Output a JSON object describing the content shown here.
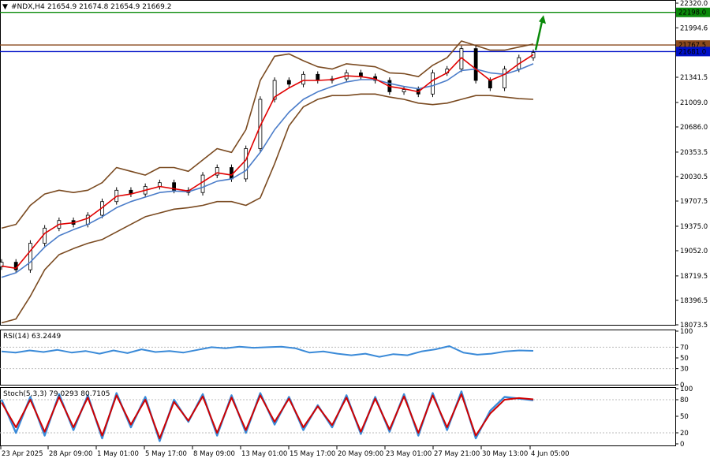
{
  "header": {
    "symbol_label": "#NDX,H4",
    "ohlc": "21654.9 21674.8 21654.9 21669.2"
  },
  "indicators": {
    "rsi_label": "RSI(14) 63.2449",
    "stoch_label": "Stoch(5,3,3) 79.0293 80.7105"
  },
  "colors": {
    "price": "#000000",
    "ema_fast": "#e00000",
    "ema_slow": "#4a7cc9",
    "bollinger": "#7a4a20",
    "resistance": "#8b4a1e",
    "support": "#0010c8",
    "target": "#0a8a0a",
    "rsi": "#3a8ad8",
    "stoch_main": "#3a8ad8",
    "stoch_signal": "#d00000"
  },
  "chart_data": [
    {
      "type": "line",
      "title": "#NDX,H4",
      "ylim": [
        18073.5,
        22320.0
      ],
      "y_ticks": [
        "22320.0",
        "21994.6",
        "21669.2",
        "21341.5",
        "21009.0",
        "20686.0",
        "20353.5",
        "20030.5",
        "19707.5",
        "19375.0",
        "19052.0",
        "18719.5",
        "18396.5",
        "18073.5"
      ],
      "x_ticks": [
        "23 Apr 2025",
        "28 Apr 09:00",
        "1 May 01:00",
        "5 May 17:00",
        "8 May 09:00",
        "13 May 01:00",
        "15 May 17:00",
        "20 May 09:00",
        "23 May 01:00",
        "27 May 21:00",
        "30 May 13:00",
        "4 Jun 05:00"
      ],
      "price_x": [
        0,
        3,
        6,
        9,
        12,
        15,
        18,
        21,
        24,
        27,
        30,
        33,
        36,
        39,
        42,
        45,
        48,
        51,
        54,
        57,
        60,
        63,
        66,
        69,
        72,
        75,
        78,
        81,
        84,
        87,
        90,
        93,
        96,
        99,
        102,
        105,
        108,
        111
      ],
      "price_close": [
        18900,
        18800,
        19150,
        19350,
        19450,
        19400,
        19520,
        19700,
        19850,
        19800,
        19900,
        19950,
        19850,
        19820,
        20050,
        20150,
        20000,
        20400,
        21050,
        21300,
        21250,
        21380,
        21300,
        21320,
        21400,
        21350,
        21300,
        21150,
        21180,
        21120,
        21400,
        21450,
        21720,
        21300,
        21200,
        21450,
        21600,
        21669
      ],
      "price_markers": [
        {
          "label": "22198.0",
          "value": 22198.0,
          "color": "#0a8a0a"
        },
        {
          "label": "21767.5",
          "value": 21767.5,
          "color": "#8b4a1e"
        },
        {
          "label": "21681.0",
          "value": 21681.0,
          "color": "#0010c8"
        }
      ],
      "series": [
        {
          "values": [
            18850,
            18820,
            19050,
            19280,
            19400,
            19420,
            19480,
            19620,
            19770,
            19800,
            19850,
            19900,
            19870,
            19840,
            19960,
            20080,
            20050,
            20250,
            20700,
            21080,
            21200,
            21300,
            21300,
            21310,
            21360,
            21350,
            21320,
            21220,
            21190,
            21150,
            21300,
            21400,
            21600,
            21450,
            21300,
            21380,
            21520,
            21640
          ]
        },
        {
          "values": [
            18700,
            18760,
            18900,
            19100,
            19250,
            19330,
            19400,
            19500,
            19620,
            19700,
            19760,
            19820,
            19840,
            19830,
            19890,
            19970,
            20000,
            20110,
            20350,
            20650,
            20880,
            21050,
            21150,
            21220,
            21280,
            21310,
            21310,
            21260,
            21220,
            21190,
            21230,
            21300,
            21430,
            21450,
            21400,
            21380,
            21440,
            21520
          ]
        },
        {
          "values": [
            19350,
            19400,
            19650,
            19800,
            19850,
            19820,
            19850,
            19950,
            20150,
            20100,
            20050,
            20150,
            20150,
            20100,
            20250,
            20400,
            20350,
            20650,
            21300,
            21620,
            21650,
            21560,
            21480,
            21450,
            21520,
            21500,
            21480,
            21400,
            21390,
            21350,
            21500,
            21600,
            21820,
            21760,
            21700,
            21700,
            21740,
            21780
          ]
        },
        {
          "values": [
            18100,
            18150,
            18450,
            18800,
            19000,
            19080,
            19150,
            19200,
            19300,
            19400,
            19500,
            19550,
            19600,
            19620,
            19650,
            19700,
            19700,
            19650,
            19750,
            20200,
            20700,
            20950,
            21050,
            21100,
            21100,
            21120,
            21120,
            21080,
            21050,
            21000,
            20980,
            21000,
            21050,
            21100,
            21100,
            21080,
            21060,
            21050
          ]
        }
      ]
    },
    {
      "type": "line",
      "title": "RSI(14) 63.2449",
      "ylim": [
        0,
        100
      ],
      "y_ticks": [
        "100",
        "70",
        "50",
        "30",
        "0"
      ],
      "series": [
        {
          "values": [
            62,
            60,
            64,
            61,
            65,
            60,
            63,
            58,
            64,
            59,
            66,
            61,
            63,
            60,
            65,
            70,
            68,
            71,
            69,
            70,
            71,
            68,
            60,
            62,
            58,
            55,
            58,
            52,
            57,
            55,
            62,
            66,
            72,
            60,
            56,
            58,
            62,
            64,
            63.2
          ]
        }
      ]
    },
    {
      "type": "line",
      "title": "Stoch(5,3,3) 79.0293 80.7105",
      "ylim": [
        0,
        100
      ],
      "y_ticks": [
        "100",
        "80",
        "50",
        "20",
        "0"
      ],
      "series": [
        {
          "values": [
            80,
            20,
            85,
            15,
            90,
            25,
            88,
            10,
            92,
            30,
            85,
            5,
            80,
            40,
            90,
            15,
            88,
            20,
            92,
            35,
            85,
            25,
            70,
            30,
            88,
            18,
            85,
            22,
            90,
            15,
            92,
            25,
            95,
            10,
            60,
            85,
            82,
            79
          ]
        },
        {
          "values": [
            75,
            30,
            80,
            22,
            85,
            30,
            84,
            15,
            88,
            35,
            80,
            10,
            76,
            42,
            86,
            20,
            84,
            25,
            88,
            40,
            82,
            30,
            68,
            34,
            84,
            22,
            82,
            26,
            86,
            20,
            88,
            30,
            90,
            15,
            55,
            80,
            83,
            80.7
          ]
        }
      ]
    }
  ]
}
